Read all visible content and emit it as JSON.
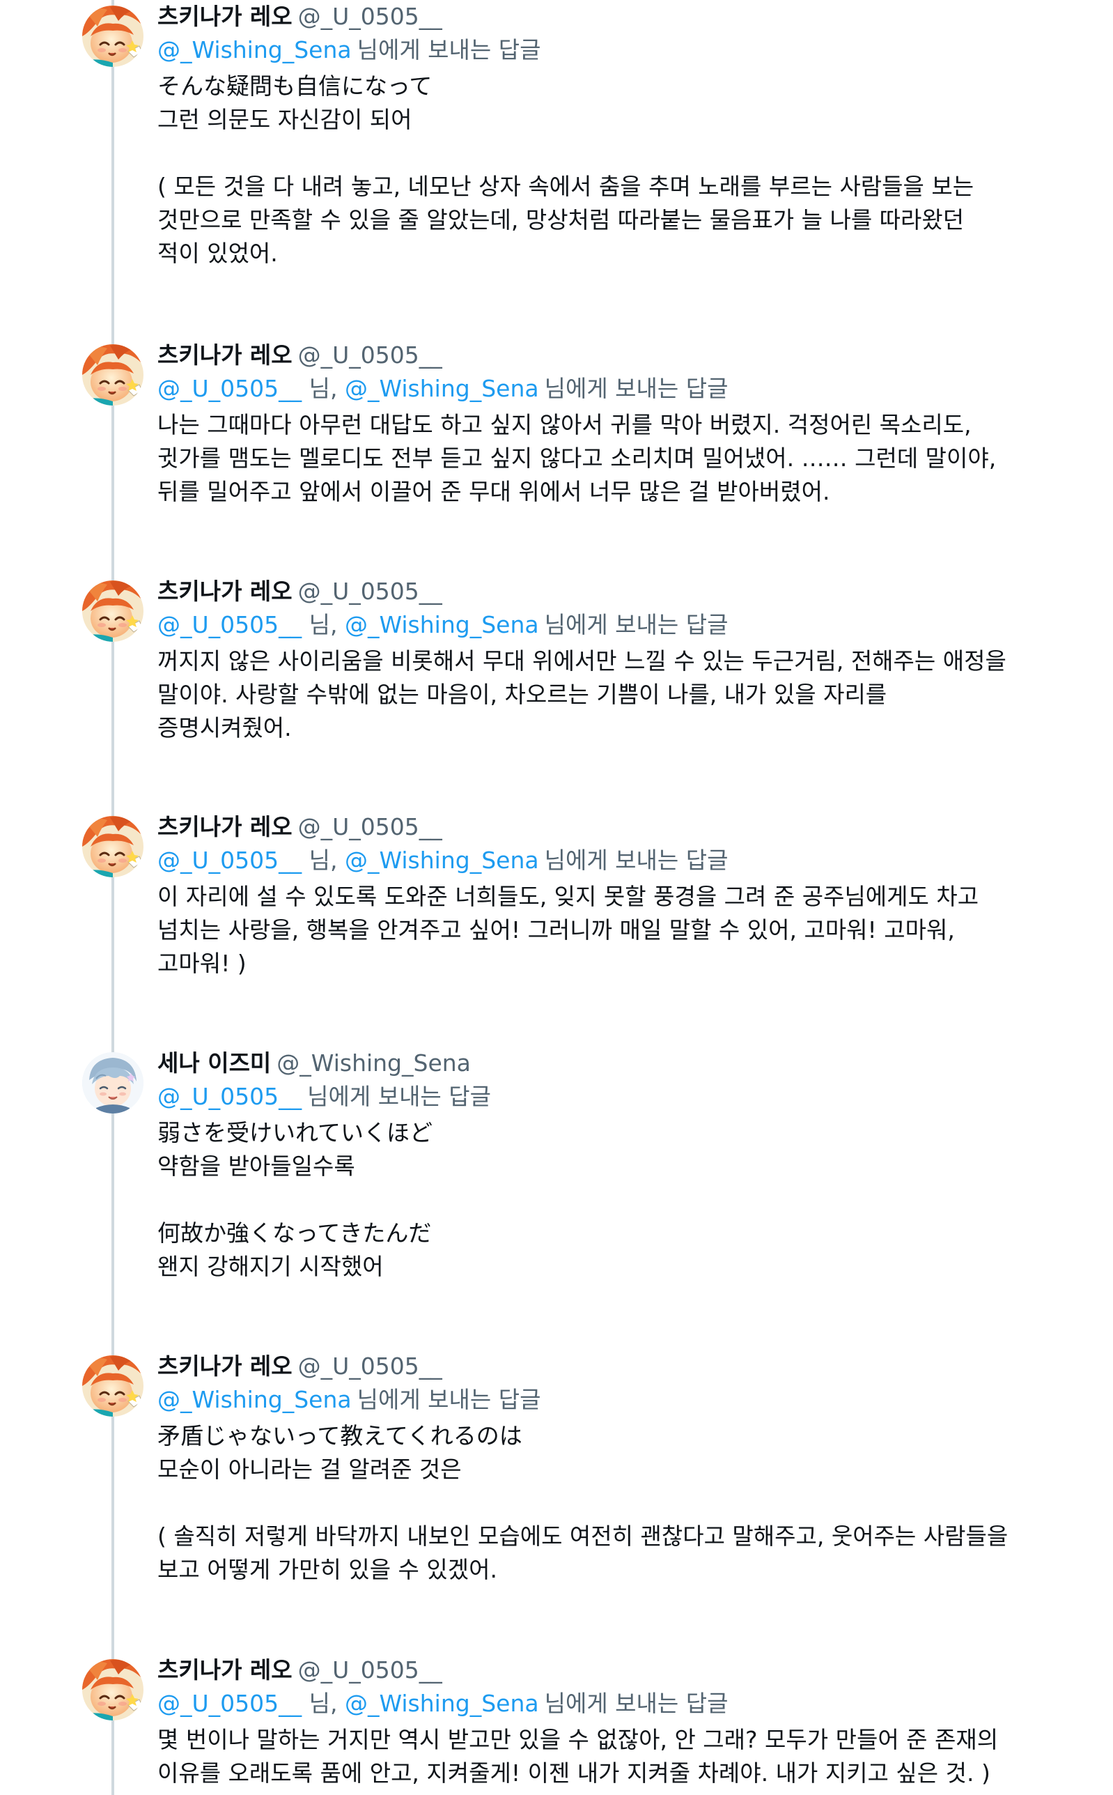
{
  "tweets": [
    {
      "author": "츠키나가 레오",
      "handle": "@_U_0505__",
      "avatar": "leo",
      "reply_to": [
        "@_Wishing_Sena"
      ],
      "reply_suffix": "님에게 보내는 답글",
      "text": "そんな疑問も自信になって\n그런 의문도 자신감이 되어\n\n( 모든 것을 다 내려 놓고, 네모난 상자 속에서 춤을 추며 노래를 부르는 사람들을 보는\n것만으로 만족할 수 있을 줄 알았는데, 망상처럼 따라붙는 물음표가 늘 나를 따라왔던\n적이 있었어."
    },
    {
      "author": "츠키나가 레오",
      "handle": "@_U_0505__",
      "avatar": "leo",
      "reply_to": [
        "@_U_0505__",
        "@_Wishing_Sena"
      ],
      "reply_suffix": "님에게 보내는 답글",
      "text": "나는 그때마다 아무런 대답도 하고 싶지 않아서 귀를 막아 버렸지. 걱정어린 목소리도,\n귓가를 맴도는 멜로디도 전부 듣고 싶지 않다고 소리치며 밀어냈어. …… 그런데 말이야,\n뒤를 밀어주고 앞에서 이끌어 준 무대 위에서 너무 많은 걸 받아버렸어."
    },
    {
      "author": "츠키나가 레오",
      "handle": "@_U_0505__",
      "avatar": "leo",
      "reply_to": [
        "@_U_0505__",
        "@_Wishing_Sena"
      ],
      "reply_suffix": "님에게 보내는 답글",
      "text": "꺼지지 않은 사이리움을 비롯해서 무대 위에서만 느낄 수 있는 두근거림, 전해주는 애정을\n말이야. 사랑할 수밖에 없는 마음이, 차오르는 기쁨이 나를, 내가 있을 자리를\n증명시켜줬어."
    },
    {
      "author": "츠키나가 레오",
      "handle": "@_U_0505__",
      "avatar": "leo",
      "reply_to": [
        "@_U_0505__",
        "@_Wishing_Sena"
      ],
      "reply_suffix": "님에게 보내는 답글",
      "text": "이 자리에 설 수 있도록 도와준 너희들도, 잊지 못할 풍경을 그려 준 공주님에게도 차고\n넘치는 사랑을, 행복을 안겨주고 싶어! 그러니까 매일 말할 수 있어, 고마워! 고마워,\n고마워! )"
    },
    {
      "author": "세나 이즈미",
      "handle": "@_Wishing_Sena",
      "avatar": "sena",
      "reply_to": [
        "@_U_0505__"
      ],
      "reply_suffix": "님에게 보내는 답글",
      "text": "弱さを受けいれていくほど\n약함을 받아들일수록\n\n何故か強くなってきたんだ\n왠지 강해지기 시작했어"
    },
    {
      "author": "츠키나가 레오",
      "handle": "@_U_0505__",
      "avatar": "leo",
      "reply_to": [
        "@_Wishing_Sena"
      ],
      "reply_suffix": "님에게 보내는 답글",
      "text": "矛盾じゃないって教えてくれるのは\n모순이 아니라는 걸 알려준 것은\n\n( 솔직히 저렇게 바닥까지 내보인 모습에도 여전히 괜찮다고 말해주고, 웃어주는 사람들을\n보고 어떻게 가만히 있을 수 있겠어."
    },
    {
      "author": "츠키나가 레오",
      "handle": "@_U_0505__",
      "avatar": "leo",
      "reply_to": [
        "@_U_0505__",
        "@_Wishing_Sena"
      ],
      "reply_suffix": "님에게 보내는 답글",
      "text": "몇 번이나 말하는 거지만 역시 받고만 있을 수 없잖아, 안 그래? 모두가 만들어 준 존재의\n이유를 오래도록 품에 안고, 지켜줄게! 이젠 내가 지켜줄 차례야. 내가 지키고 싶은 것. )"
    }
  ],
  "colors": {
    "text": "#0f1419",
    "secondary": "#536471",
    "link": "#1d9bf0",
    "thread_line": "#cfd9de"
  }
}
